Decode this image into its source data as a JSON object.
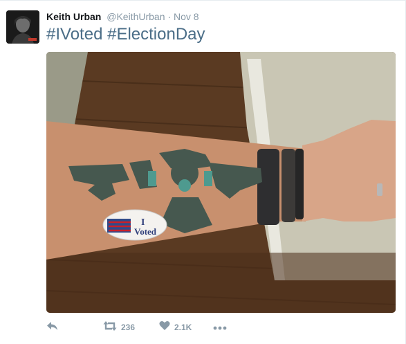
{
  "tweet": {
    "author_name": "Keith Urban",
    "author_handle": "@KeithUrban",
    "separator": "·",
    "timestamp": "Nov 8",
    "hashtags": [
      "#IVoted",
      "#ElectionDay"
    ],
    "media": {
      "sticker_line1": "I",
      "sticker_line2": "Voted"
    },
    "actions": {
      "reply_icon": "reply-icon",
      "retweet_icon": "retweet-icon",
      "retweet_count": "236",
      "like_icon": "heart-icon",
      "like_count": "2.1K",
      "more_icon": "more-icon"
    }
  },
  "colors": {
    "hashtag": "#4a6d87",
    "meta_gray": "#8899a6",
    "name": "#14171a"
  }
}
